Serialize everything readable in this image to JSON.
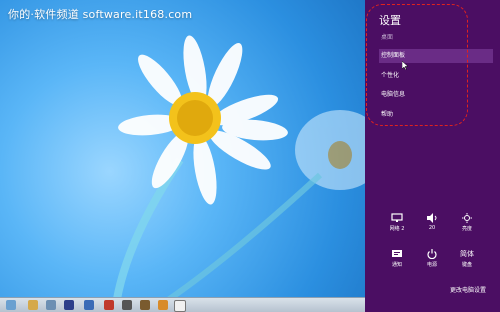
{
  "watermark": "你的·软件频道 software.it168.com",
  "charms": {
    "title": "设置",
    "items": [
      {
        "label": "桌面",
        "state": "dim"
      },
      {
        "label": "控制面板",
        "state": "selected"
      },
      {
        "label": "个性化",
        "state": "normal"
      },
      {
        "label": "电脑信息",
        "state": "normal"
      },
      {
        "label": "帮助",
        "state": "normal"
      }
    ],
    "quick": [
      {
        "label": "网络 2",
        "icon": "network-icon"
      },
      {
        "label": "20",
        "icon": "volume-icon"
      },
      {
        "label": "亮度",
        "icon": "brightness-icon"
      },
      {
        "label": "通知",
        "icon": "notifications-icon"
      },
      {
        "label": "电源",
        "icon": "power-icon"
      },
      {
        "label": "键盘",
        "icon": "keyboard-icon",
        "icon_text": "简体"
      }
    ],
    "change_pc_settings": "更改电脑设置"
  },
  "colors": {
    "charms_bg": "#4b0e63",
    "selected_bg": "#6a2c86",
    "annotation": "#e0221e"
  }
}
